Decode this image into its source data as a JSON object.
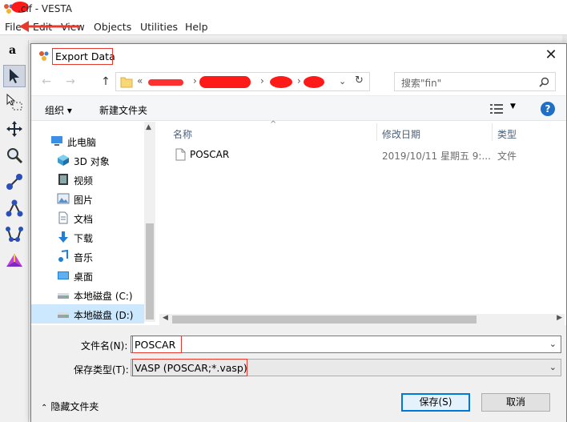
{
  "app": {
    "title": ".cif - VESTA",
    "menu": [
      "File",
      "Edit",
      "View",
      "Objects",
      "Utilities",
      "Help"
    ]
  },
  "left_toolbar": {
    "label": "a",
    "tools": [
      "select-arrow",
      "select-box",
      "move",
      "magnify",
      "distance",
      "angle",
      "dihedral",
      "boundary"
    ]
  },
  "dialog": {
    "title": "Export Data",
    "close_label": "✕",
    "address": {
      "prefix": "«",
      "separator": "›"
    },
    "search": {
      "placeholder": "搜索\"fin\""
    },
    "commands": {
      "organize": "组织 ▾",
      "new_folder": "新建文件夹",
      "help": "?"
    },
    "nav": [
      {
        "label": "此电脑",
        "icon": "computer-icon",
        "indent": 0
      },
      {
        "label": "3D 对象",
        "icon": "3d-objects-icon",
        "indent": 1
      },
      {
        "label": "视频",
        "icon": "video-icon",
        "indent": 1
      },
      {
        "label": "图片",
        "icon": "pictures-icon",
        "indent": 1
      },
      {
        "label": "文档",
        "icon": "documents-icon",
        "indent": 1
      },
      {
        "label": "下载",
        "icon": "downloads-icon",
        "indent": 1
      },
      {
        "label": "音乐",
        "icon": "music-icon",
        "indent": 1
      },
      {
        "label": "桌面",
        "icon": "desktop-icon",
        "indent": 1
      },
      {
        "label": "本地磁盘 (C:)",
        "icon": "drive-icon",
        "indent": 1
      },
      {
        "label": "本地磁盘 (D:)",
        "icon": "drive-icon",
        "indent": 1,
        "selected": true
      }
    ],
    "columns": {
      "name": "名称",
      "modified": "修改日期",
      "type": "类型"
    },
    "files": [
      {
        "name": "POSCAR",
        "modified": "2019/10/11 星期五 9:...",
        "type": "文件"
      }
    ],
    "filename_label": "文件名(N):",
    "filename_value": "POSCAR",
    "filetype_label": "保存类型(T):",
    "filetype_value": "VASP (POSCAR;*.vasp)",
    "save_button": "保存(S)",
    "cancel_button": "取消",
    "hide_folders": "隐藏文件夹"
  },
  "colors": {
    "annotation_red": "#e8392e",
    "selection_blue": "#cce8ff",
    "accent": "#0078d7"
  }
}
